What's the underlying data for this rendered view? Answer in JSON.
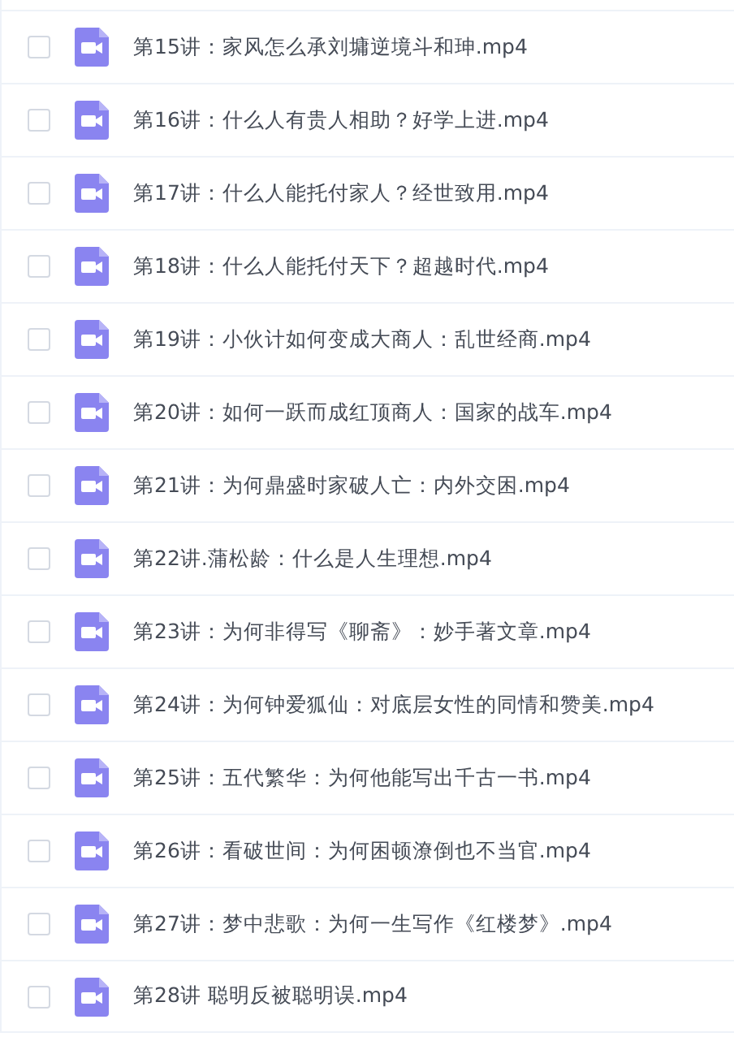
{
  "files": [
    {
      "name": "第15讲：家风怎么承刘墉逆境斗和珅.mp4",
      "checked": false
    },
    {
      "name": "第16讲：什么人有贵人相助？好学上进.mp4",
      "checked": false
    },
    {
      "name": "第17讲：什么人能托付家人？经世致用.mp4",
      "checked": false
    },
    {
      "name": "第18讲：什么人能托付天下？超越时代.mp4",
      "checked": false
    },
    {
      "name": "第19讲：小伙计如何变成大商人：乱世经商.mp4",
      "checked": false
    },
    {
      "name": "第20讲：如何一跃而成红顶商人：国家的战车.mp4",
      "checked": false
    },
    {
      "name": "第21讲：为何鼎盛时家破人亡：内外交困.mp4",
      "checked": false
    },
    {
      "name": "第22讲.蒲松龄：什么是人生理想.mp4",
      "checked": false
    },
    {
      "name": "第23讲：为何非得写《聊斋》：妙手著文章.mp4",
      "checked": false
    },
    {
      "name": "第24讲：为何钟爱狐仙：对底层女性的同情和赞美.mp4",
      "checked": false
    },
    {
      "name": "第25讲：五代繁华：为何他能写出千古一书.mp4",
      "checked": false
    },
    {
      "name": "第26讲：看破世间：为何困顿潦倒也不当官.mp4",
      "checked": false
    },
    {
      "name": "第27讲：梦中悲歌：为何一生写作《红楼梦》.mp4",
      "checked": false
    },
    {
      "name": "第28讲 聪明反被聪明误.mp4",
      "checked": false
    }
  ]
}
